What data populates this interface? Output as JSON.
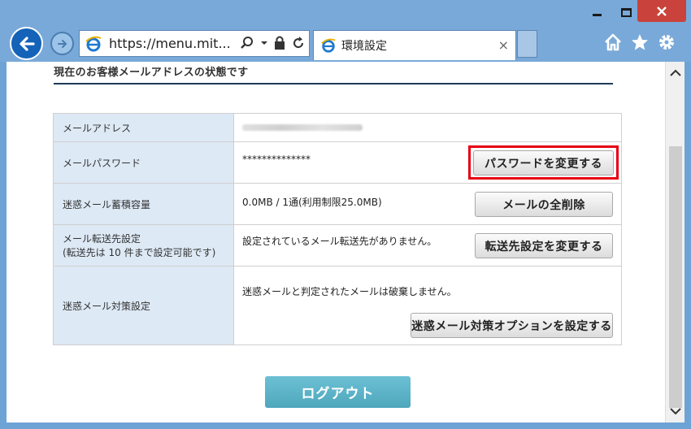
{
  "browser": {
    "address_url": "https://menu.mit...",
    "tab_title": "環境設定",
    "tab_close": "×"
  },
  "page": {
    "section_title": "現在のお客様メールアドレスの状態です",
    "rows": [
      {
        "label": "メールアドレス",
        "value": ""
      },
      {
        "label": "メールパスワード",
        "value": "**************",
        "button": "パスワードを変更する"
      },
      {
        "label": "迷惑メール蓄積容量",
        "value": "0.0MB / 1通(利用制限25.0MB)",
        "button": "メールの全削除"
      },
      {
        "label_line1": "メール転送先設定",
        "label_line2": "(転送先は 10 件まで設定可能です)",
        "value": "設定されているメール転送先がありません。",
        "button": "転送先設定を変更する"
      },
      {
        "label": "迷惑メール対策設定",
        "value": "迷惑メールと判定されたメールは破棄しません。",
        "button": "迷惑メール対策オプションを設定する"
      }
    ],
    "logout_label": "ログアウト"
  },
  "colors": {
    "highlight": "#e60012",
    "logout": "#5bb3c8",
    "label_bg": "#dde9f5",
    "chrome": "#79a9d9"
  },
  "icons": [
    "back-arrow-icon",
    "forward-arrow-icon",
    "ie-logo-icon",
    "search-icon",
    "dropdown-icon",
    "lock-icon",
    "refresh-icon",
    "home-icon",
    "favorites-star-icon",
    "settings-gear-icon",
    "minimize-icon",
    "maximize-icon",
    "close-icon",
    "scroll-up-icon",
    "scroll-down-icon"
  ]
}
